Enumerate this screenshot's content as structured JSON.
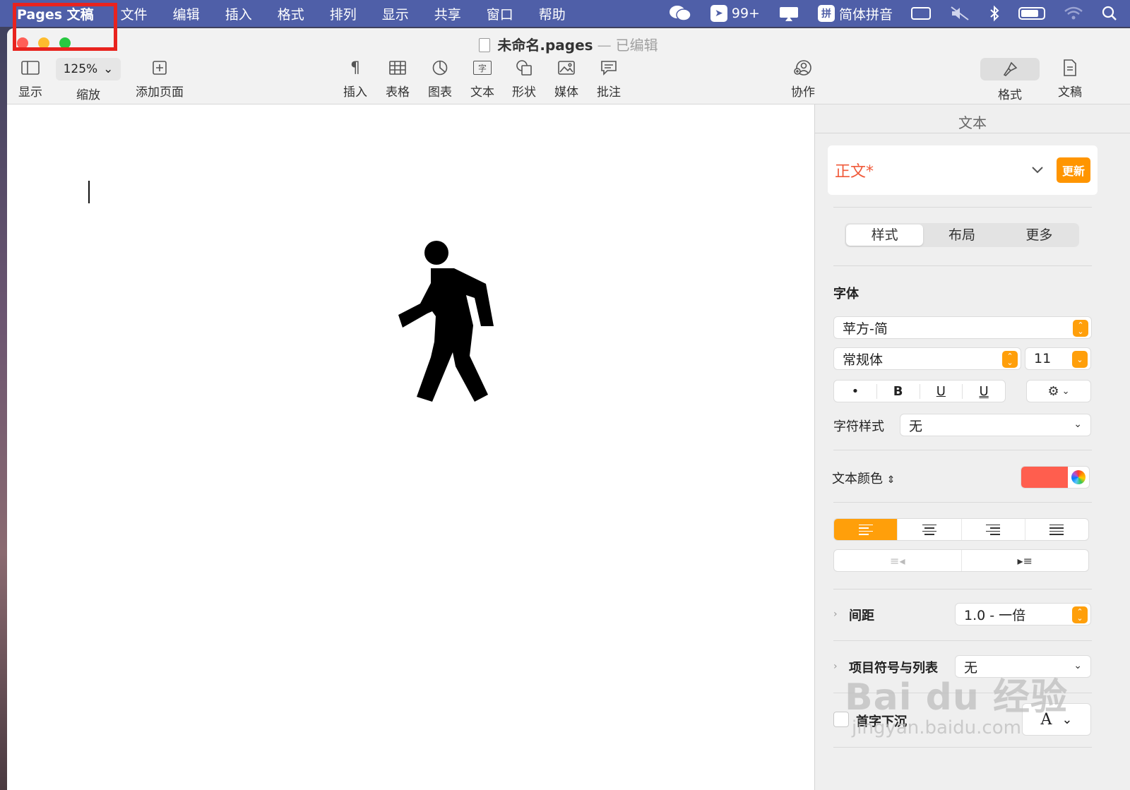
{
  "menubar": {
    "app_name": "Pages 文稿",
    "items": [
      "文件",
      "编辑",
      "插入",
      "格式",
      "排列",
      "显示",
      "共享",
      "窗口",
      "帮助"
    ],
    "status": {
      "notification_count": "99+",
      "input_method": "简体拼音",
      "input_method_icon": "拼"
    }
  },
  "window": {
    "title": "未命名.pages",
    "title_separator": "—",
    "edited": "已编辑"
  },
  "toolbar": {
    "view_label": "显示",
    "zoom_value": "125%",
    "zoom_label": "缩放",
    "add_page_label": "添加页面",
    "insert_label": "插入",
    "table_label": "表格",
    "chart_label": "图表",
    "text_label": "文本",
    "shape_label": "形状",
    "media_label": "媒体",
    "comment_label": "批注",
    "collaborate_label": "协作",
    "format_label": "格式",
    "document_label": "文稿",
    "text_icon_glyph": "字"
  },
  "inspector": {
    "title": "文本",
    "paragraph_style": "正文*",
    "update_label": "更新",
    "tabs": [
      "样式",
      "布局",
      "更多"
    ],
    "font_section": "字体",
    "font_family": "苹方-简",
    "font_typeface": "常规体",
    "font_size": "11",
    "format_buttons": [
      "•",
      "B",
      "U",
      "U"
    ],
    "char_style_label": "字符样式",
    "char_style_value": "无",
    "text_color_label": "文本颜色",
    "text_color": "#ff5e4e",
    "spacing_label": "间距",
    "spacing_value": "1.0 - 一倍",
    "bullets_label": "项目符号与列表",
    "bullets_value": "无",
    "dropcap_label": "首字下沉",
    "dropcap_glyph": "A"
  },
  "watermark": {
    "line1": "Bai du 经验",
    "line2": "jingyan.baidu.com"
  },
  "colors": {
    "menubar": "#4f5fa8",
    "accent": "#ff9f0a",
    "highlight": "#e8231e"
  }
}
